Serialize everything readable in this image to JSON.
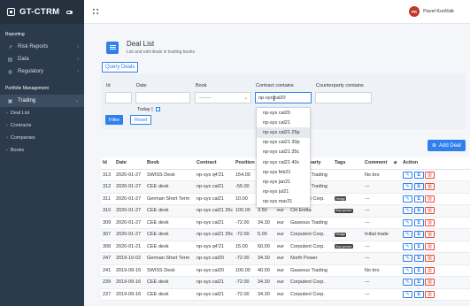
{
  "app": {
    "brand": "GT-CTRM"
  },
  "user": {
    "initials": "PK",
    "name": "Pavel Kurilčák"
  },
  "sidebar": {
    "sections": [
      {
        "title": "Reporting"
      },
      {
        "title": "Portfolio Management"
      }
    ],
    "reporting_items": [
      {
        "label": "Risk Reports",
        "icon": "trend-icon"
      },
      {
        "label": "Data",
        "icon": "database-icon"
      },
      {
        "label": "Regulatory",
        "icon": "globe-icon"
      }
    ],
    "trading": {
      "label": "Trading",
      "icon": "briefcase-icon"
    },
    "trading_sub": [
      "Deal List",
      "Contracts",
      "Companies",
      "Books"
    ]
  },
  "page": {
    "title": "Deal List",
    "subtitle": "List and edit deals in trading books",
    "query_button": "Query Deals",
    "add_deal": "Add Deal"
  },
  "filters": {
    "id_label": "Id",
    "date_label": "Date",
    "book_label": "Book",
    "book_value": "--------",
    "contract_label": "Contract contains",
    "contract_value_before": "np-sys",
    "contract_value_after": "cal20",
    "counterparty_label": "Counterparty contains",
    "today_label": "Today |",
    "filter_button": "Filter",
    "reset_button": "Reset"
  },
  "suggestions": [
    "np-sys cal20",
    "np-sys cal21",
    "np-sys cal21 25p",
    "np-sys cal21 30p",
    "np-sys cal21 35c",
    "np-sys cal21 40c",
    "np-sys feb21",
    "np-sys jan21",
    "np-sys jul21",
    "np-sys mar21"
  ],
  "table": {
    "headers": [
      "Id",
      "Date",
      "Book",
      "Contract",
      "Position",
      "",
      "",
      "Counterparty",
      "Tags",
      "Comment",
      "",
      "Action"
    ],
    "rows": [
      [
        "313",
        "2020-01-27",
        "SWISS Desk",
        "np-sys q4'21",
        "154.00",
        "",
        "",
        "Gaseous Trading",
        "",
        "No bro"
      ],
      [
        "312",
        "2020-01-27",
        "CEE desk",
        "np-sys cal21",
        "-55.00",
        "",
        "",
        "Gaseous Trading",
        "",
        "---"
      ],
      [
        "311",
        "2020-01-27",
        "German Short Term",
        "np-sys cal21",
        "10.00",
        "",
        "",
        "Corpulent Corp.",
        "Hedge",
        "---"
      ],
      [
        "310",
        "2020-01-27",
        "CEE desk",
        "np-sys cal21 35c",
        "100.00",
        "3.50",
        "eur",
        "Citi Entita",
        "Buy spread",
        "---"
      ],
      [
        "309",
        "2020-01-27",
        "CEE desk",
        "np-sys cal21",
        "-72.00",
        "34.30",
        "eur",
        "Gaseous Trading",
        "",
        "---"
      ],
      [
        "307",
        "2020-01-27",
        "CEE desk",
        "np-sys cal21 35c",
        "-72.00",
        "5.00",
        "eur",
        "Corpulent Corp.",
        "Hedge",
        "Initial trade"
      ],
      [
        "308",
        "2020-01-21",
        "CEE desk",
        "np-sys q4'21",
        "15.00",
        "60.00",
        "eur",
        "Corpulent Corp.",
        "Buy spread",
        "---"
      ],
      [
        "247",
        "2019-10-02",
        "German Short Term",
        "np-sys cal20",
        "-72.00",
        "34.30",
        "eur",
        "North Power",
        "",
        "---"
      ],
      [
        "241",
        "2019-09-16",
        "SWISS Desk",
        "np-sys cal20",
        "100.00",
        "40.00",
        "eur",
        "Gaseous Trading",
        "",
        "No bro"
      ],
      [
        "239",
        "2019-09-16",
        "CEE desk",
        "np-sys cal21",
        "-72.00",
        "34.30",
        "eur",
        "Corpulent Corp.",
        "",
        "---"
      ],
      [
        "237",
        "2019-09-16",
        "CEE desk",
        "np-sys cal21",
        "-72.00",
        "34.30",
        "eur",
        "Corpulent Corp.",
        "",
        "---"
      ]
    ]
  },
  "colors": {
    "accent": "#2f80ed",
    "sidebar": "#2b3a4d",
    "danger": "#e74c3c"
  }
}
